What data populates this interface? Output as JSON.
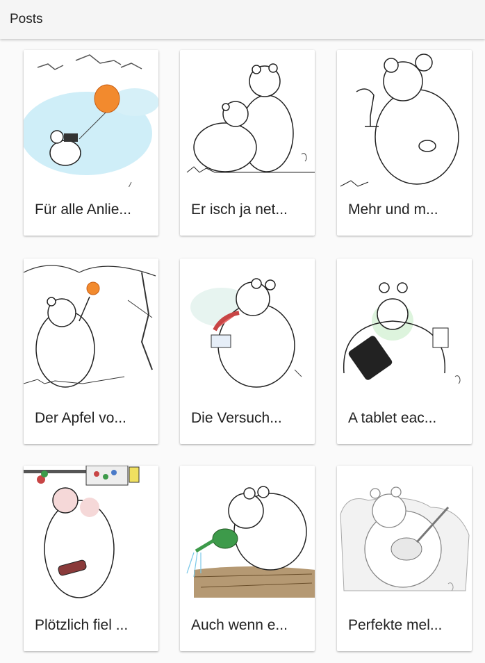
{
  "appbar": {
    "title": "Posts"
  },
  "posts": [
    {
      "title": "Für alle Anlie...",
      "image": "bear-with-balloon-sky"
    },
    {
      "title": "Er isch ja net...",
      "image": "two-bears-hugging"
    },
    {
      "title": "Mehr und m...",
      "image": "bear-with-wine-glass"
    },
    {
      "title": "Der Apfel vo...",
      "image": "bear-under-apple-tree"
    },
    {
      "title": "Die Versuch...",
      "image": "bear-tongue-out"
    },
    {
      "title": "A tablet eac...",
      "image": "bear-with-tablet"
    },
    {
      "title": "Plötzlich fiel ...",
      "image": "bear-with-bottle"
    },
    {
      "title": "Auch wenn e...",
      "image": "bear-watering-garden"
    },
    {
      "title": "Perfekte mel...",
      "image": "bear-playing-guitar"
    }
  ],
  "colors": {
    "appbar_bg": "#f5f5f5",
    "page_bg": "#fafafa",
    "card_bg": "#ffffff",
    "title_text": "#212121",
    "balloon": "#f28a2e",
    "sky": "#bfe8f5",
    "watering_can": "#3d9a4a",
    "soil": "#a8875a",
    "tongue": "#e46a6a"
  }
}
